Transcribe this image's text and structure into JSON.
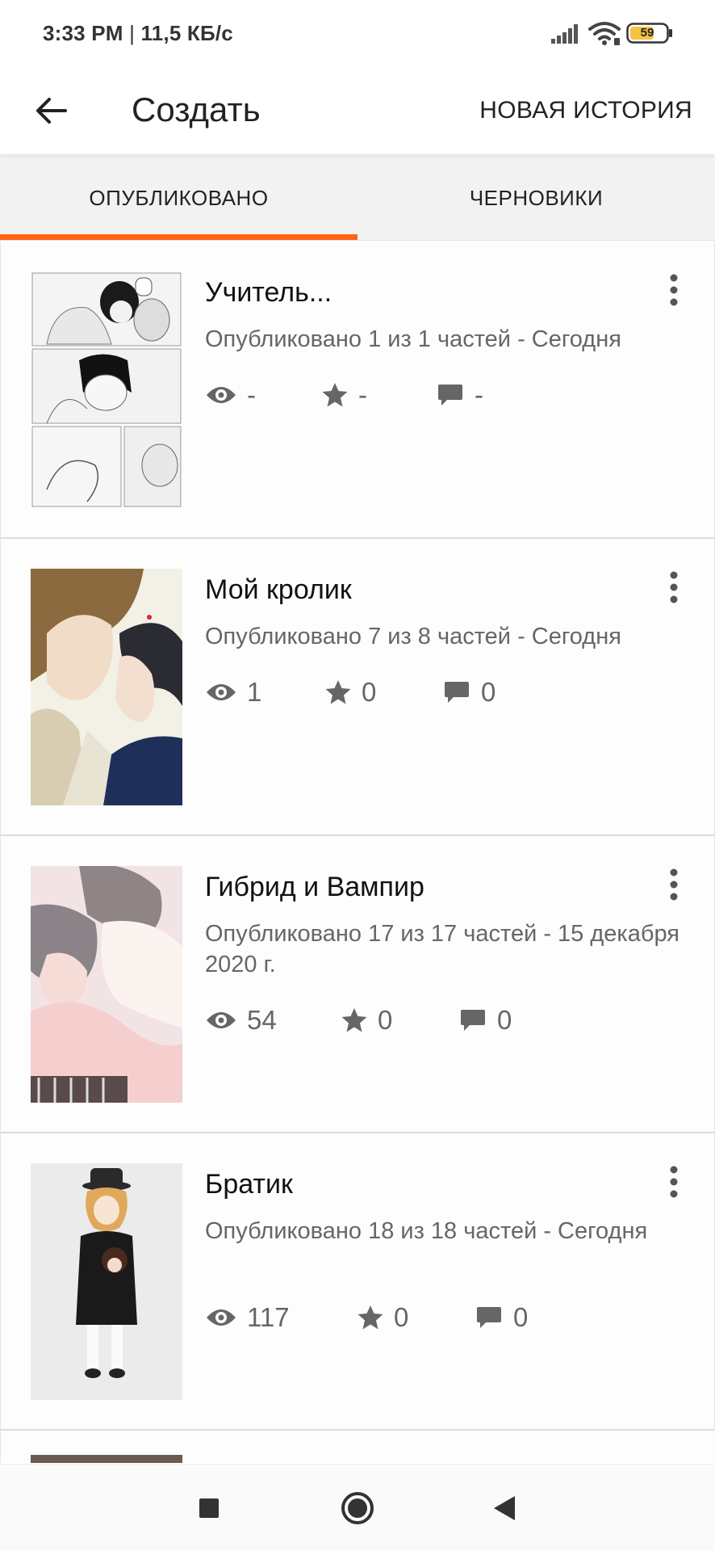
{
  "status_bar": {
    "time": "3:33 PM",
    "separator": "|",
    "speed": "11,5 КБ/с",
    "battery": "59"
  },
  "header": {
    "title": "Создать",
    "new_story": "НОВАЯ ИСТОРИЯ",
    "back_icon": "arrow-left-icon"
  },
  "tabs": {
    "published": "ОПУБЛИКОВАНО",
    "drafts": "ЧЕРНОВИКИ",
    "active": "published",
    "accent_color": "#ff6414"
  },
  "stories": [
    {
      "title": "Учитель...",
      "meta": "Опубликовано 1 из 1 частей - Сегодня",
      "views": "-",
      "votes": "-",
      "comments": "-"
    },
    {
      "title": "Мой кролик",
      "meta": "Опубликовано 7 из 8 частей - Сегодня",
      "views": "1",
      "votes": "0",
      "comments": "0"
    },
    {
      "title": "Гибрид и Вампир",
      "meta": "Опубликовано 17 из 17 частей - 15 декабря 2020 г.",
      "views": "54",
      "votes": "0",
      "comments": "0"
    },
    {
      "title": "Братик",
      "meta": "Опубликовано 18 из 18 частей - Сегодня",
      "views": "117",
      "votes": "0",
      "comments": "0"
    }
  ],
  "icons": {
    "views": "eye-icon",
    "votes": "star-icon",
    "comments": "comment-icon",
    "menu": "more-vertical-icon",
    "nav_recents": "square-icon",
    "nav_home": "circle-icon",
    "nav_back": "triangle-back-icon"
  }
}
